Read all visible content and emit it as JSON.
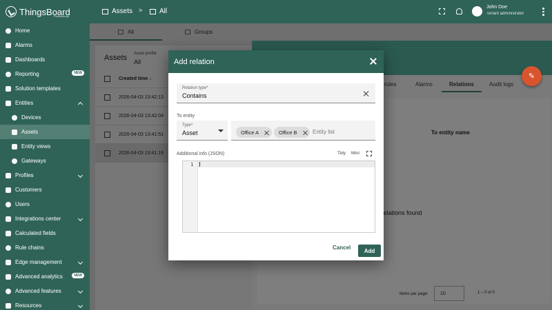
{
  "brand": {
    "name": "ThingsBoard",
    "edition": "Professional"
  },
  "sidebar": {
    "items": [
      {
        "label": "Home",
        "name": "home",
        "icon": "home-icon"
      },
      {
        "label": "Alarms",
        "name": "alarms",
        "icon": "bell-icon"
      },
      {
        "label": "Dashboards",
        "name": "dashboards",
        "icon": "dashboard-icon"
      },
      {
        "label": "Reporting",
        "name": "reporting",
        "icon": "report-icon",
        "badge": "NEW"
      },
      {
        "label": "Solution templates",
        "name": "solution-templates",
        "icon": "template-icon"
      },
      {
        "label": "Entities",
        "name": "entities",
        "icon": "entities-icon",
        "chevron": "up"
      },
      {
        "label": "Devices",
        "name": "devices",
        "icon": "devices-icon",
        "sub": true
      },
      {
        "label": "Assets",
        "name": "assets",
        "icon": "domain-icon",
        "sub": true,
        "active": true
      },
      {
        "label": "Entity views",
        "name": "entity-views",
        "icon": "view-icon",
        "sub": true
      },
      {
        "label": "Gateways",
        "name": "gateways",
        "icon": "gateway-icon",
        "sub": true
      },
      {
        "label": "Profiles",
        "name": "profiles",
        "icon": "profiles-icon",
        "chevron": "down"
      },
      {
        "label": "Customers",
        "name": "customers",
        "icon": "customers-icon"
      },
      {
        "label": "Users",
        "name": "users",
        "icon": "user-icon"
      },
      {
        "label": "Integrations center",
        "name": "integrations-center",
        "icon": "integrations-icon",
        "chevron": "down"
      },
      {
        "label": "Calculated fields",
        "name": "calculated-fields",
        "icon": "function-icon"
      },
      {
        "label": "Rule chains",
        "name": "rule-chains",
        "icon": "rule-chain-icon"
      },
      {
        "label": "Edge management",
        "name": "edge-management",
        "icon": "edge-icon",
        "chevron": "down"
      },
      {
        "label": "Advanced analytics",
        "name": "advanced-analytics",
        "icon": "analytics-icon",
        "badge": "NEW"
      },
      {
        "label": "Advanced features",
        "name": "advanced-features",
        "icon": "features-icon",
        "chevron": "down"
      },
      {
        "label": "Resources",
        "name": "resources",
        "icon": "folder-icon",
        "chevron": "down"
      }
    ]
  },
  "topbar": {
    "crumb_assets": "Assets",
    "crumb_sep": ">",
    "crumb_all": "All",
    "user_name": "John Doe",
    "user_role": "Tenant administrator"
  },
  "page_tabs": {
    "all": "All",
    "groups": "Groups"
  },
  "assets_list": {
    "title": "Assets",
    "profile_label": "Asset profile",
    "profile_value": "All",
    "created_time_header": "Created time",
    "rows": [
      "2026-04-03 13:42:13",
      "2026-04-03 13:42:04",
      "2026-04-03 13:41:51",
      "2026-04-03 13:41:19"
    ]
  },
  "details": {
    "tabs": [
      "rules",
      "Alarms",
      "Relations",
      "Audit logs"
    ],
    "to_entity_name_header": "To entity name",
    "empty_text": "o relations found",
    "items_per_page_label": "Items per page:",
    "items_per_page": "10",
    "range": "1 – 0 of 0"
  },
  "dialog": {
    "title": "Add relation",
    "relation_type_label": "Relation type*",
    "relation_type_value": "Contains",
    "to_entity_label": "To entity",
    "type_label": "Type*",
    "type_value": "Asset",
    "chips": [
      "Office A",
      "Office B"
    ],
    "entity_list_placeholder": "Entity list",
    "additional_info_label": "Additional info (JSON)",
    "tidy_label": "Tidy",
    "mini_label": "Mini",
    "line_number": "1",
    "cancel_label": "Cancel",
    "add_label": "Add"
  },
  "colors": {
    "primary": "#2f6357",
    "accent": "#d8542e"
  }
}
